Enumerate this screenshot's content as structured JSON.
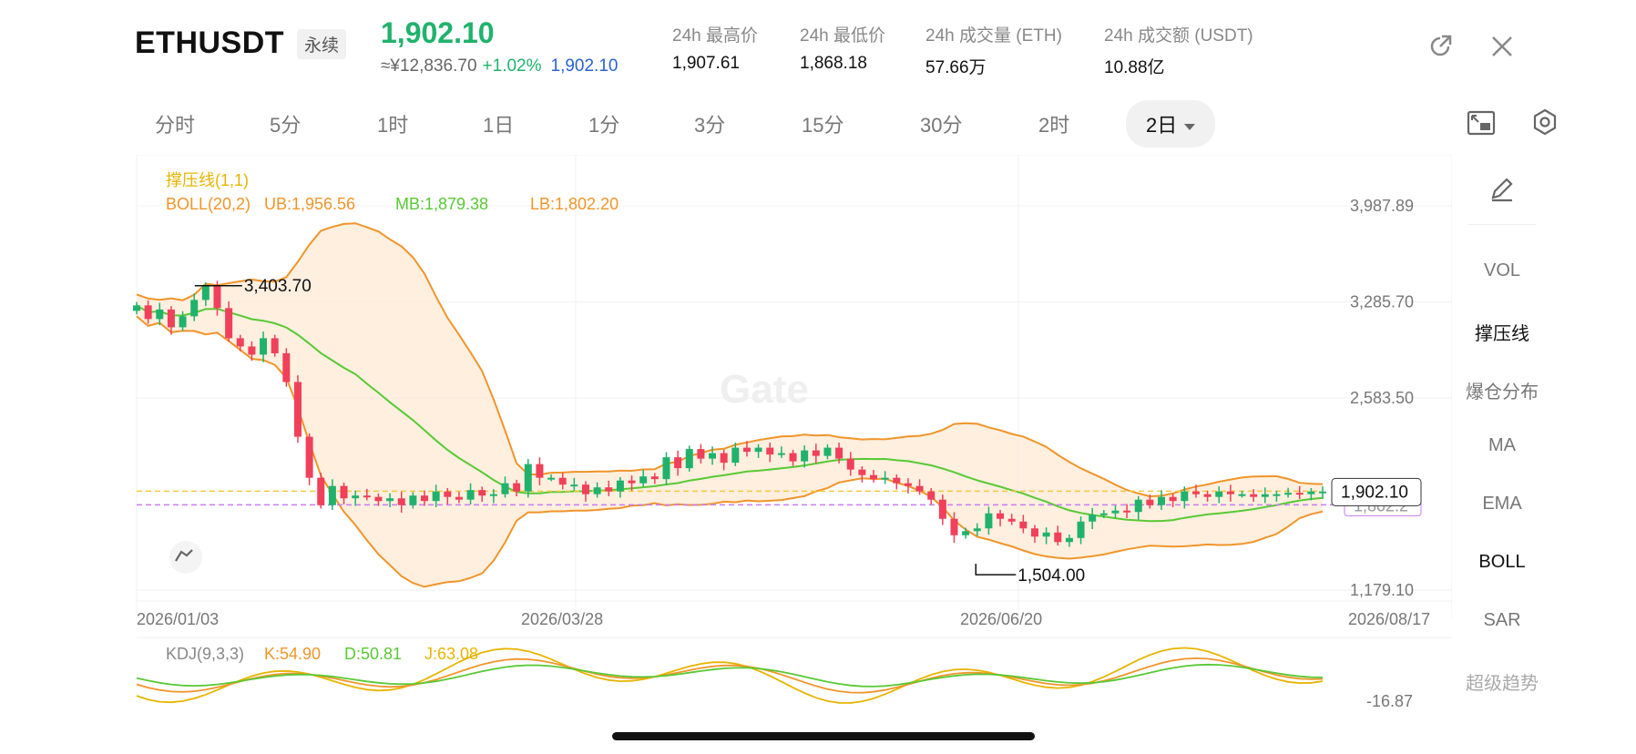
{
  "header": {
    "symbol": "ETHUSDT",
    "contract_tag": "永续",
    "last_price": "1,902.10",
    "cny_price": "≈¥12,836.70",
    "change_pct": "+1.02%",
    "mark_price": "1,902.10",
    "stats": [
      {
        "label": "24h 最高价",
        "value": "1,907.61"
      },
      {
        "label": "24h 最低价",
        "value": "1,868.18"
      },
      {
        "label": "24h 成交量 (ETH)",
        "value": "57.66万"
      },
      {
        "label": "24h 成交额 (USDT)",
        "value": "10.88亿"
      }
    ],
    "icons": [
      "share-icon",
      "close-icon"
    ]
  },
  "tabs": [
    {
      "label": "分时"
    },
    {
      "label": "5分"
    },
    {
      "label": "1时"
    },
    {
      "label": "1日"
    },
    {
      "label": "1分"
    },
    {
      "label": "3分"
    },
    {
      "label": "15分"
    },
    {
      "label": "30分"
    },
    {
      "label": "2时"
    },
    {
      "label": "2日",
      "active": true
    }
  ],
  "tab_icons": [
    "picture-in-picture-icon",
    "settings-icon"
  ],
  "indicators": {
    "support_resistance": "撑压线(1,1)",
    "boll_name": "BOLL(20,2)",
    "boll_ub": "UB:1,956.56",
    "boll_mb": "MB:1,879.38",
    "boll_lb": "LB:1,802.20",
    "kdj_name": "KDJ(9,3,3)",
    "kdj_k": "K:54.90",
    "kdj_d": "D:50.81",
    "kdj_j": "J:63.08"
  },
  "axis": {
    "price_ticks": [
      "3,987.89",
      "3,285.70",
      "2,583.50",
      "1,179.10"
    ],
    "date_ticks": [
      "2026/01/03",
      "2026/03/28",
      "2026/06/20",
      "2026/08/17"
    ],
    "kdj_tick": "-16.87"
  },
  "annotations": {
    "high_label": "3,403.70",
    "low_label": "1,504.00",
    "current_price_tag": "1,902.10",
    "line_tag": "1,802.2"
  },
  "watermark": "Gate",
  "right_panel": {
    "items": [
      {
        "label": "VOL",
        "style": "normal"
      },
      {
        "label": "撑压线",
        "style": "bold"
      },
      {
        "label": "爆仓分布",
        "style": "normal"
      },
      {
        "label": "MA",
        "style": "normal"
      },
      {
        "label": "EMA",
        "style": "normal"
      },
      {
        "label": "BOLL",
        "style": "bold"
      },
      {
        "label": "SAR",
        "style": "normal"
      },
      {
        "label": "超级趋势",
        "style": "faded"
      }
    ]
  },
  "colors": {
    "up": "#20b26c",
    "down": "#f0405a",
    "boll_band": "#f0952a",
    "mb_line": "#58c934",
    "support_line": "#f5c842",
    "resistance_line": "#c77df0",
    "brand_blue": "#2a62d4"
  },
  "chart_data": {
    "type": "candlestick",
    "ylim": [
      1179.1,
      3987.89
    ],
    "x_range": [
      "2026/01/03",
      "2026/08/17"
    ],
    "closes": [
      3260,
      3160,
      3230,
      3100,
      3180,
      3300,
      3403,
      3240,
      3020,
      2960,
      2900,
      3020,
      2910,
      2700,
      2300,
      2000,
      1800,
      1940,
      1850,
      1870,
      1860,
      1830,
      1850,
      1800,
      1870,
      1830,
      1900,
      1860,
      1840,
      1910,
      1870,
      1880,
      1960,
      1900,
      2100,
      2000,
      2000,
      1950,
      1950,
      1880,
      1930,
      1900,
      1980,
      1960,
      2010,
      1990,
      2150,
      2070,
      2210,
      2140,
      2180,
      2110,
      2220,
      2190,
      2220,
      2170,
      2180,
      2120,
      2200,
      2160,
      2220,
      2140,
      2060,
      2020,
      1990,
      2000,
      1960,
      1940,
      1900,
      1840,
      1700,
      1580,
      1610,
      1630,
      1740,
      1700,
      1680,
      1630,
      1570,
      1600,
      1530,
      1560,
      1680,
      1730,
      1740,
      1760,
      1750,
      1840,
      1800,
      1860,
      1830,
      1900,
      1880,
      1860,
      1900,
      1880,
      1880,
      1860,
      1880,
      1880,
      1890,
      1880,
      1900,
      1900
    ],
    "series": [
      {
        "name": "UB:1,956.56",
        "values": []
      },
      {
        "name": "MB:1,879.38",
        "values": []
      },
      {
        "name": "LB:1,802.20",
        "values": []
      }
    ]
  }
}
